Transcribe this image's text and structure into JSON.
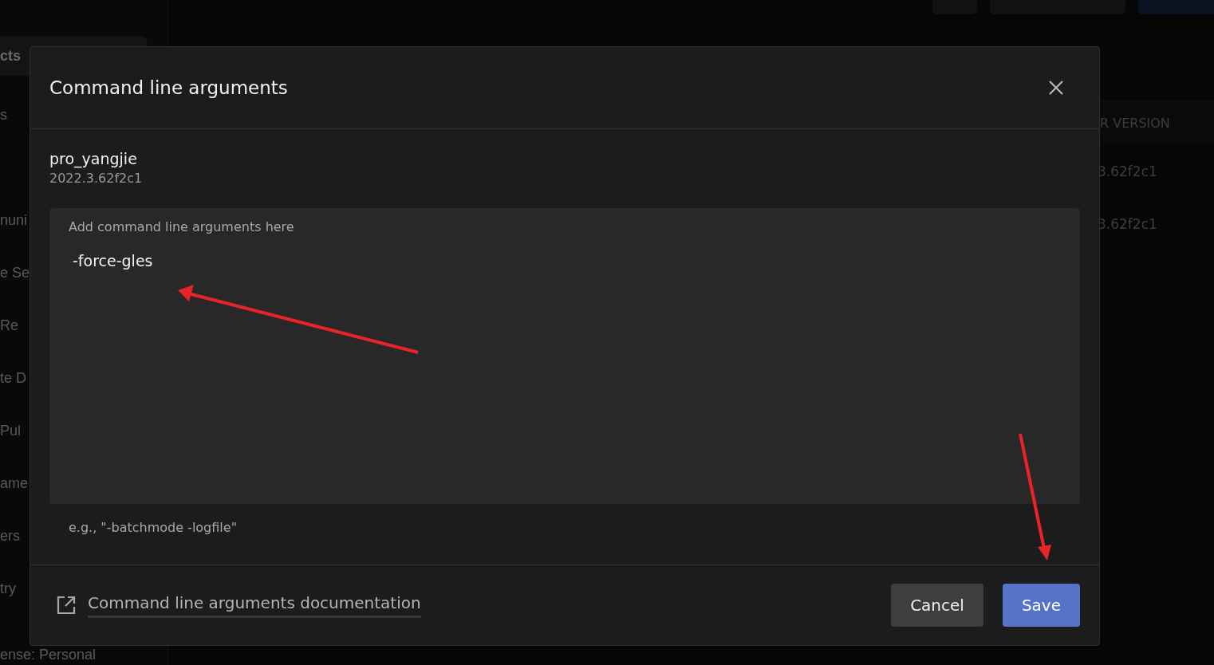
{
  "background": {
    "sidebar_items": [
      {
        "label": "cts",
        "selected": true
      },
      {
        "label": "s",
        "selected": false
      },
      {
        "label": "nuni",
        "selected": false
      },
      {
        "label": "e Se",
        "selected": false
      },
      {
        "label": "Re",
        "selected": false
      },
      {
        "label": "te D",
        "selected": false
      },
      {
        "label": "Pul",
        "selected": false
      },
      {
        "label": "ame",
        "selected": false
      },
      {
        "label": "ers",
        "selected": false
      },
      {
        "label": "try",
        "selected": false
      }
    ],
    "license": "ense: Personal",
    "table_header": "R VERSION",
    "table_rows": [
      "3.62f2c1",
      "3.62f2c1"
    ]
  },
  "dialog": {
    "title": "Command line arguments",
    "project_name": "pro_yangjie",
    "project_version": "2022.3.62f2c1",
    "field": {
      "label": "Add command line arguments here",
      "value": "-force-gles"
    },
    "hint": "e.g., \"-batchmode -logfile\"",
    "doc_link": "Command line arguments documentation",
    "buttons": [
      {
        "label": "Cancel",
        "kind": "secondary"
      },
      {
        "label": "Save",
        "kind": "primary"
      }
    ]
  }
}
